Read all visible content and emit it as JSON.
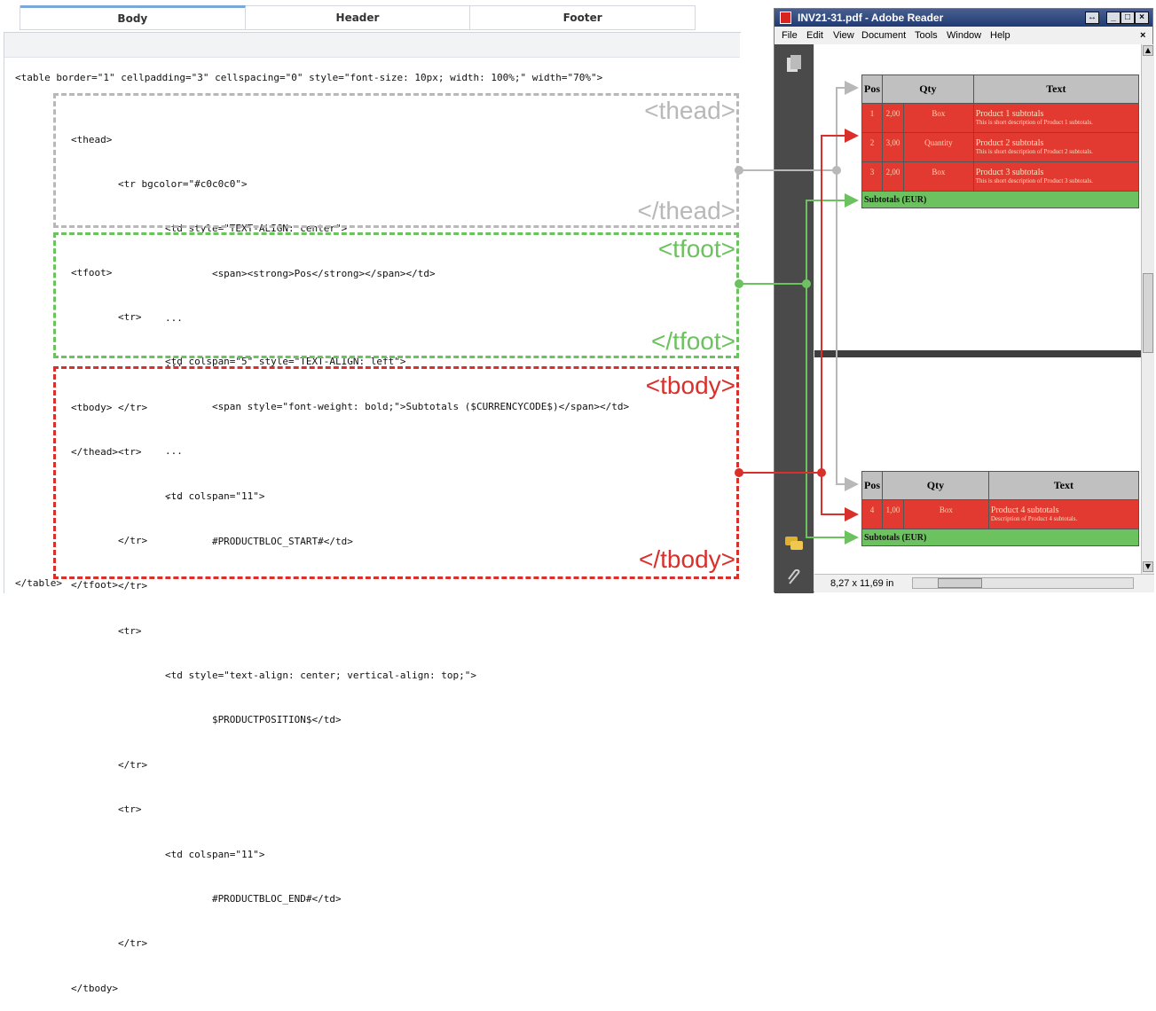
{
  "tabs": [
    {
      "label": "Body",
      "active": true
    },
    {
      "label": "Header",
      "active": false
    },
    {
      "label": "Footer",
      "active": false
    }
  ],
  "code": {
    "top_line": "<table border=\"1\" cellpadding=\"3\" cellspacing=\"0\" style=\"font-size: 10px; width: 100%;\" width=\"70%\">",
    "thead_lines": [
      "<thead>",
      "        <tr bgcolor=\"#c0c0c0\">",
      "                <td style=\"TEXT-ALIGN: center\">",
      "                        <span><strong>Pos</strong></span></td>",
      "                ...",
      "                ...",
      "        </tr>",
      "</thead>"
    ],
    "tfoot_lines": [
      "<tfoot>",
      "        <tr>",
      "                <td colspan=\"5\" style=\"TEXT-ALIGN: left\">",
      "                        <span style=\"font-weight: bold;\">Subtotals ($CURRENCYCODE$)</span></td>",
      "                ...",
      "                ...",
      "        </tr>",
      "</tfoot>"
    ],
    "tbody_lines": [
      "<tbody>",
      "        <tr>",
      "                <td colspan=\"11\">",
      "                        #PRODUCTBLOC_START#</td>",
      "        </tr>",
      "        <tr>",
      "                <td style=\"text-align: center; vertical-align: top;\">",
      "                        $PRODUCTPOSITION$</td>",
      "        </tr>",
      "        <tr>",
      "                <td colspan=\"11\">",
      "                        #PRODUCTBLOC_END#</td>",
      "        </tr>",
      "</tbody>"
    ],
    "end_line": "</table>"
  },
  "labels": {
    "thead_open": "<thead>",
    "thead_close": "</thead>",
    "tfoot_open": "<tfoot>",
    "tfoot_close": "</tfoot>",
    "tbody_open": "<tbody>",
    "tbody_close": "</tbody>"
  },
  "reader": {
    "title": "INV21-31.pdf - Adobe Reader",
    "menu": [
      "File",
      "Edit",
      "View",
      "Document",
      "Tools",
      "Window",
      "Help"
    ],
    "page_size": "8,27 x 11,69 in",
    "table1": {
      "headers": [
        "Pos",
        "Qty",
        "Text"
      ],
      "rows": [
        {
          "pos": "1",
          "qty": "2,00",
          "unit": "Box",
          "text": "Product 1 subtotals",
          "desc": "This is short description of Product 1 subtotals."
        },
        {
          "pos": "2",
          "qty": "3,00",
          "unit": "Quantity",
          "text": "Product 2 subtotals",
          "desc": "This is short description of Product 2 subtotals."
        },
        {
          "pos": "3",
          "qty": "2,00",
          "unit": "Box",
          "text": "Product 3 subtotals",
          "desc": "This is short description of Product 3 subtotals."
        }
      ],
      "subtotal": "Subtotals (EUR)"
    },
    "table2": {
      "headers": [
        "Pos",
        "Qty",
        "Text"
      ],
      "rows": [
        {
          "pos": "4",
          "qty": "1,00",
          "unit": "Box",
          "text": "Product 4 subtotals",
          "desc": "Description of Product 4 subtotals."
        }
      ],
      "subtotal": "Subtotals (EUR)"
    }
  },
  "colors": {
    "thead": "#b8b8b8",
    "tfoot": "#6cc25e",
    "tbody": "#d9302b",
    "tab_active": "#7aa7d8"
  }
}
